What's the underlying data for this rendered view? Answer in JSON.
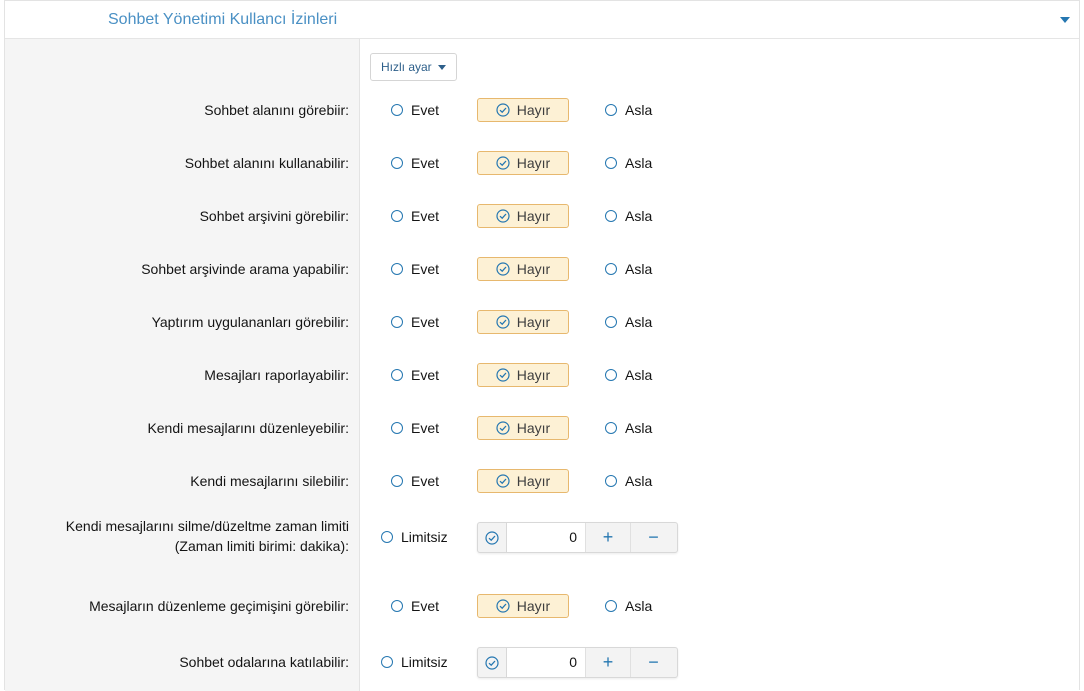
{
  "section": {
    "title": "Sohbet Yönetimi Kullancı İzinleri",
    "toggle_icon": "caret-down-icon"
  },
  "quick_settings": {
    "label": "Hızlı ayar"
  },
  "options": {
    "yes": "Evet",
    "no": "Hayır",
    "never": "Asla",
    "unlimited": "Limitsiz"
  },
  "colors": {
    "accent": "#2577b1",
    "selected_bg": "#fdf1d5",
    "selected_border": "#e7b86e",
    "title": "#4a90c4"
  },
  "permissions": [
    {
      "label": "Sohbet alanını görebiir:",
      "type": "radio",
      "selected": "Hayır"
    },
    {
      "label": "Sohbet alanını kullanabilir:",
      "type": "radio",
      "selected": "Hayır"
    },
    {
      "label": "Sohbet arşivini görebilir:",
      "type": "radio",
      "selected": "Hayır"
    },
    {
      "label": "Sohbet arşivinde arama yapabilir:",
      "type": "radio",
      "selected": "Hayır"
    },
    {
      "label": "Yaptırım uygulananları görebilir:",
      "type": "radio",
      "selected": "Hayır"
    },
    {
      "label": "Mesajları raporlayabilir:",
      "type": "radio",
      "selected": "Hayır"
    },
    {
      "label": "Kendi mesajlarını düzenleyebilir:",
      "type": "radio",
      "selected": "Hayır"
    },
    {
      "label": "Kendi mesajlarını silebilir:",
      "type": "radio",
      "selected": "Hayır"
    },
    {
      "label": "Kendi mesajlarını silme/düzeltme zaman limiti",
      "label2": "(Zaman limiti birimi: dakika):",
      "type": "number",
      "value": "0"
    },
    {
      "label": "Mesajların düzenleme geçimişini görebilir:",
      "type": "radio",
      "selected": "Hayır"
    },
    {
      "label": "Sohbet odalarına katılabilir:",
      "type": "number",
      "value": "0"
    }
  ],
  "spin_buttons": {
    "plus": "+",
    "minus": "−"
  }
}
